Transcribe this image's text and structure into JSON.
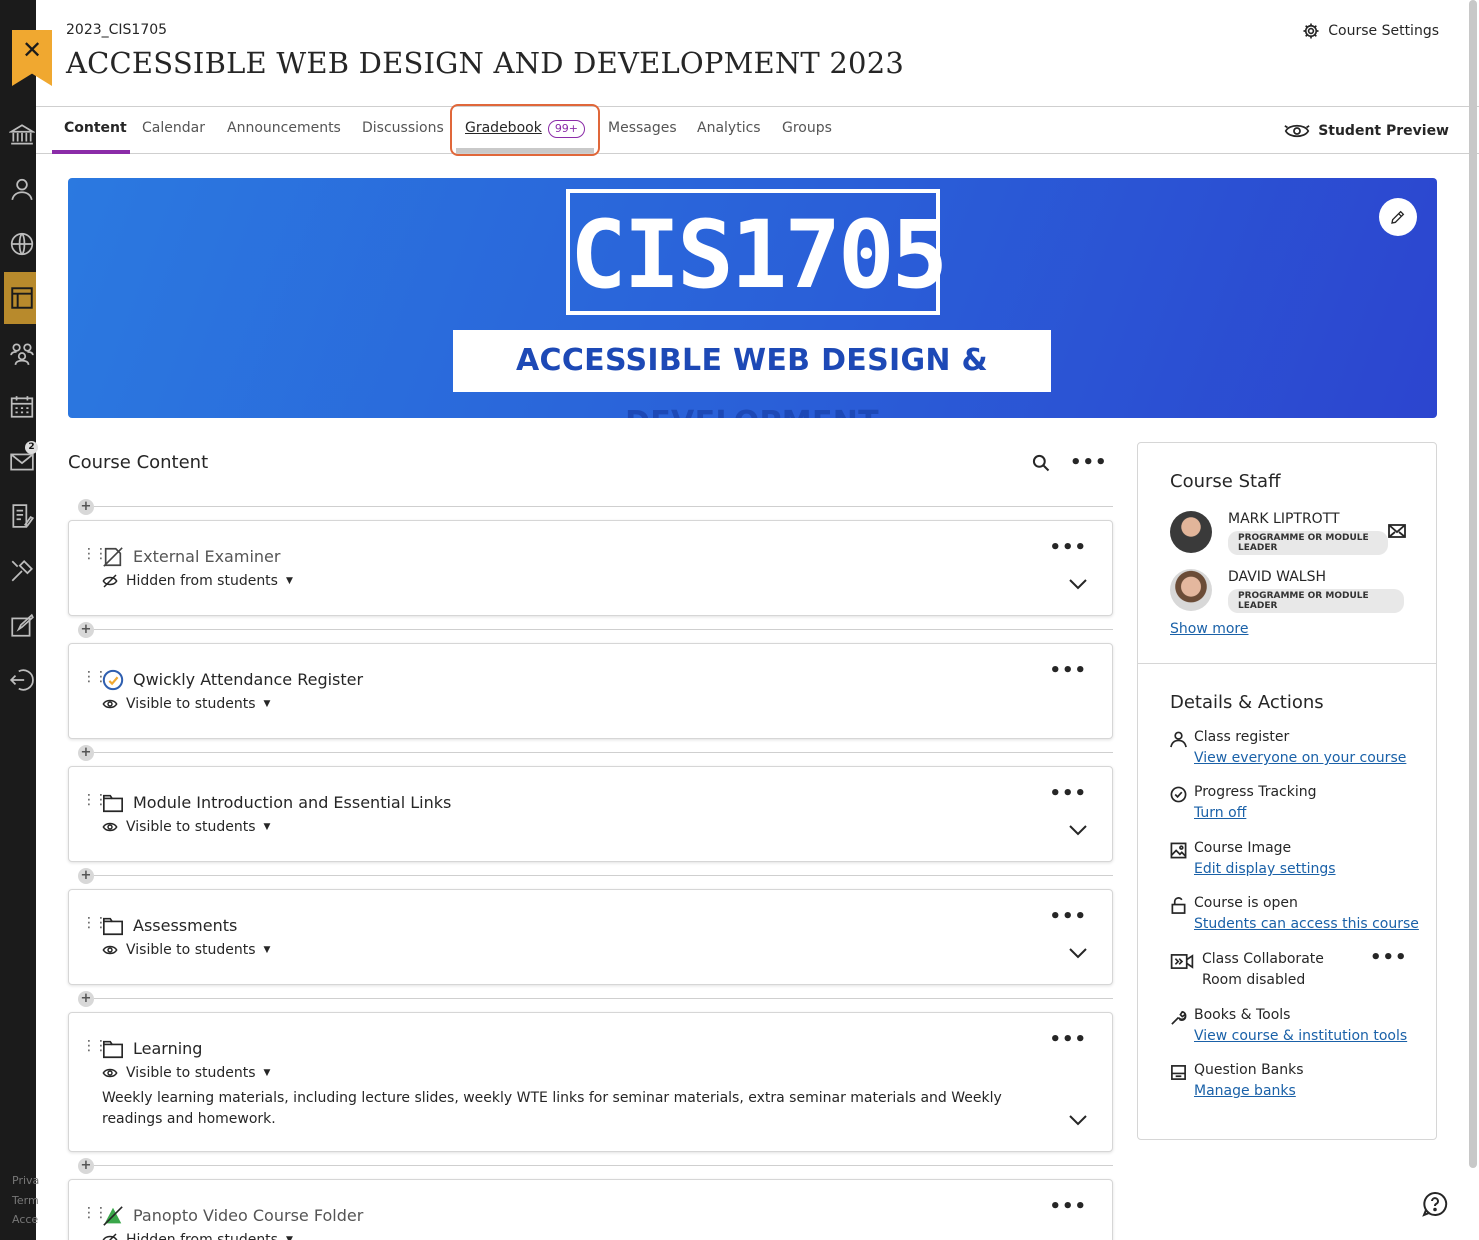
{
  "header": {
    "course_code": "2023_CIS1705",
    "course_title": "ACCESSIBLE WEB DESIGN AND DEVELOPMENT 2023",
    "settings_label": "Course Settings",
    "close_label": "✕"
  },
  "rail": {
    "messages_badge": "2",
    "footer": [
      "Priva",
      "Term",
      "Acce"
    ]
  },
  "tabs": [
    {
      "label": "Content"
    },
    {
      "label": "Calendar"
    },
    {
      "label": "Announcements"
    },
    {
      "label": "Discussions"
    },
    {
      "label": "Gradebook",
      "badge": "99+"
    },
    {
      "label": "Messages"
    },
    {
      "label": "Analytics"
    },
    {
      "label": "Groups"
    }
  ],
  "student_preview_label": "Student Preview",
  "banner": {
    "code": "CIS1705",
    "subtitle": "ACCESSIBLE WEB DESIGN & DEVELOPMENT",
    "bg_start": "#2b79e0",
    "bg_end": "#2c45cf"
  },
  "course_content": {
    "heading": "Course Content",
    "items": [
      {
        "title": "External Examiner",
        "visibility": "Hidden from students",
        "icon": "hidden-document-icon"
      },
      {
        "title": "Qwickly Attendance Register",
        "visibility": "Visible to students",
        "icon": "qwickly-logo-icon"
      },
      {
        "title": "Module Introduction and Essential Links",
        "visibility": "Visible to students",
        "icon": "folder-icon"
      },
      {
        "title": "Assessments",
        "visibility": "Visible to students",
        "icon": "folder-icon"
      },
      {
        "title": "Learning",
        "visibility": "Visible to students",
        "icon": "folder-icon",
        "description": "Weekly learning materials, including lecture slides, weekly WTE links for seminar materials, extra seminar materials and Weekly readings and homework."
      },
      {
        "title": "Panopto Video Course Folder",
        "visibility": "Hidden from students",
        "icon": "panopto-logo-icon"
      }
    ]
  },
  "course_staff": {
    "heading": "Course Staff",
    "members": [
      {
        "name": "MARK LIPTROTT",
        "role": "PROGRAMME OR MODULE LEADER"
      },
      {
        "name": "DAVID WALSH",
        "role": "PROGRAMME OR MODULE LEADER"
      }
    ],
    "show_more": "Show more"
  },
  "details": {
    "heading": "Details & Actions",
    "items": [
      {
        "label": "Class register",
        "sub": "View everyone on your course",
        "link": true
      },
      {
        "label": "Progress Tracking",
        "sub": "Turn off",
        "link": true
      },
      {
        "label": "Course Image",
        "sub": "Edit display settings",
        "link": true
      },
      {
        "label": "Course is open",
        "sub": "Students can access this course",
        "link": true
      },
      {
        "label": "Class Collaborate",
        "sub": "Room disabled",
        "link": false
      },
      {
        "label": "Books & Tools",
        "sub": "View course & institution tools",
        "link": true
      },
      {
        "label": "Question Banks",
        "sub": "Manage banks",
        "link": true
      }
    ]
  },
  "colors": {
    "accent": "#8b2ca8",
    "highlight": "#e0673a",
    "link": "#1a61a8",
    "close": "#f0a830"
  }
}
